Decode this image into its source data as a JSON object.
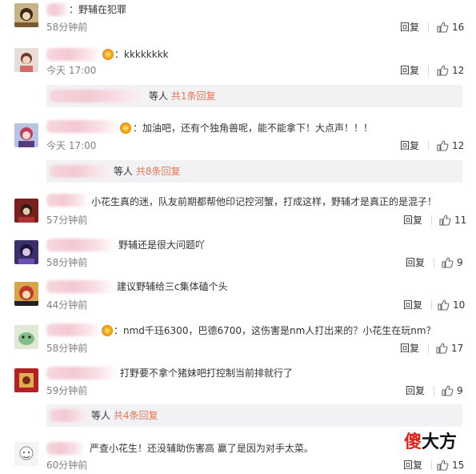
{
  "comments": [
    {
      "text": "：野辅在犯罪",
      "time": "58分钟前",
      "reply": "回复",
      "likes": "16"
    },
    {
      "text": "：kkkkkkkk",
      "time": "今天 17:00",
      "reply": "回复",
      "likes": "12"
    },
    {
      "text": "：加油吧，还有个独角兽呢，能不能拿下！大点声！！！",
      "time": "今天 17:00",
      "reply": "回复",
      "likes": "12"
    },
    {
      "text": "小花生真的迷，队友前期都帮他印记控河蟹，打成这样，野辅才是真正的是混子！",
      "time": "57分钟前",
      "reply": "回复",
      "likes": "11"
    },
    {
      "text": "野辅还是很大问题吖",
      "time": "58分钟前",
      "reply": "回复",
      "likes": "9"
    },
    {
      "text": "建议野辅给三c集体磕个头",
      "time": "44分钟前",
      "reply": "回复",
      "likes": "10"
    },
    {
      "text": "：nmd千珏6300，巴德6700，这伤害是nm人打出来的？小花生在玩nm？",
      "time": "58分钟前",
      "reply": "回复",
      "likes": "17"
    },
    {
      "text": "打野要不拿个猪妹吧打控制当前排就行了",
      "time": "59分钟前",
      "reply": "回复",
      "likes": "9"
    },
    {
      "text": "严查小花生！还没辅助伤害高  赢了是因为对手太菜。",
      "time": "60分钟前",
      "reply": "回复",
      "likes": "15"
    }
  ],
  "sub_replies": [
    {
      "prefix": "等人",
      "count": "共1条回复"
    },
    {
      "prefix": "等人",
      "count": "共8条回复"
    },
    {
      "prefix": "等人",
      "count": "共4条回复"
    }
  ],
  "watermark": {
    "part1": "傻",
    "part2": "大方"
  }
}
